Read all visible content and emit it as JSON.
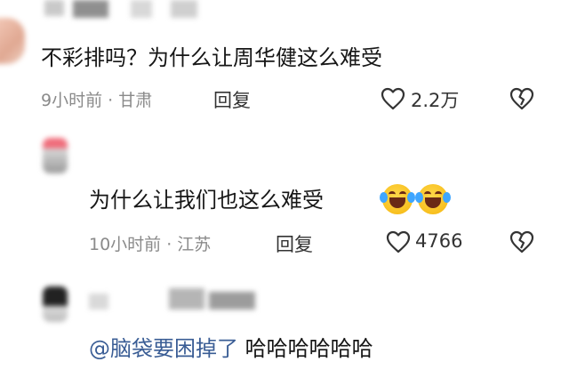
{
  "comments": [
    {
      "text": "不彩排吗？为什么让周华健这么难受",
      "meta": "9小时前 · 甘肃",
      "reply_label": "回复",
      "like_count": "2.2万"
    },
    {
      "text": "为什么让我们也这么难受",
      "emojis": [
        "laugh-cry-emoji",
        "laugh-cry-emoji"
      ],
      "meta": "10小时前 · 江苏",
      "reply_label": "回复",
      "like_count": "4766"
    },
    {
      "mention": "@脑袋要困掉了",
      "text": " 哈哈哈哈哈哈"
    }
  ],
  "icons": {
    "like": "heart-outline-icon",
    "dislike": "broken-heart-icon"
  },
  "colors": {
    "mention": "#3a5d95",
    "meta": "#8a8a8a",
    "text": "#161616"
  }
}
